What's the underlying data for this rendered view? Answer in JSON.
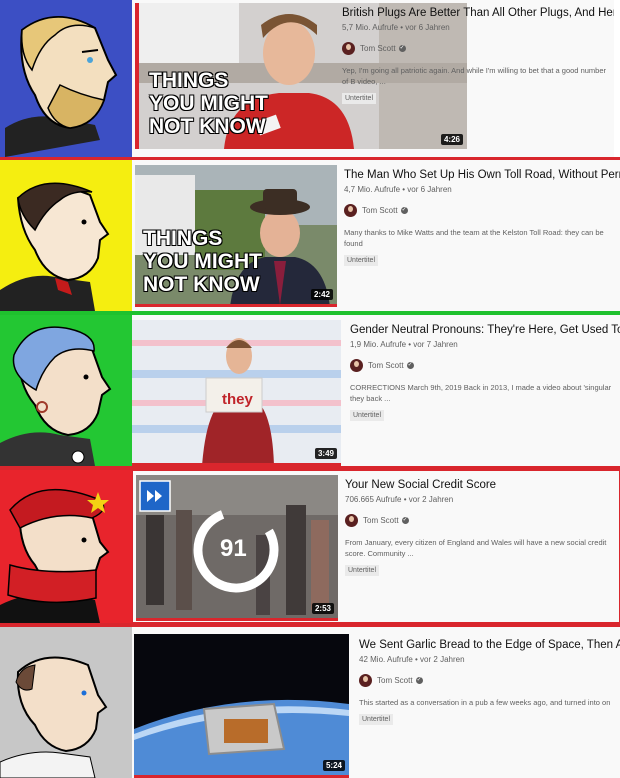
{
  "rows": [
    {
      "title": "British Plugs Are Better Than All Other Plugs, And Here's Why",
      "views": "5,7 Mio. Aufrufe • vor 6 Jahren",
      "channel": "Tom Scott",
      "desc": "Yep, I'm going all patriotic again. And while I'm willing to bet that a good number of B video, ...",
      "badge": "Untertitel",
      "duration": "4:26",
      "overlay": [
        "THINGS",
        "YOU MIGHT",
        "NOT KNOW"
      ]
    },
    {
      "title": "The Man Who Set Up His Own Toll Road, Without Permission",
      "views": "4,7 Mio. Aufrufe • vor 6 Jahren",
      "channel": "Tom Scott",
      "desc": "Many thanks to Mike Watts and the team at the Kelston Toll Road: they can be found",
      "badge": "Untertitel",
      "duration": "2:42",
      "overlay": [
        "THINGS",
        "YOU MIGHT",
        "NOT KNOW"
      ]
    },
    {
      "title": "Gender Neutral Pronouns: They're Here, Get Used To Them",
      "views": "1,9 Mio. Aufrufe • vor 7 Jahren",
      "channel": "Tom Scott",
      "desc": "CORRECTIONS March 9th, 2019 Back in 2013, I made a video about 'singular they back ...",
      "badge": "Untertitel",
      "duration": "3:49",
      "sign": "they"
    },
    {
      "title": "Your New Social Credit Score",
      "views": "706.665 Aufrufe • vor 2 Jahren",
      "channel": "Tom Scott",
      "desc": "From January, every citizen of England and Wales will have a new social credit score. Community ...",
      "badge": "Untertitel",
      "duration": "2:53",
      "score": "91"
    },
    {
      "title": "We Sent Garlic Bread to the Edge of Space, Then Ate It",
      "views": "42 Mio. Aufrufe • vor 2 Jahren",
      "channel": "Tom Scott",
      "desc": "This started as a conversation in a pub a few weeks ago, and turned into on",
      "badge": "Untertitel",
      "duration": "5:24"
    }
  ],
  "colors": {
    "row1_panel": "#3c4fc4",
    "row2_panel": "#f5ee10",
    "row3_panel": "#23c733",
    "row4_panel": "#e8242c",
    "row5_panel": "#c7c7c7",
    "separator_red": "#d9262d",
    "separator_green": "#1fc12e"
  }
}
